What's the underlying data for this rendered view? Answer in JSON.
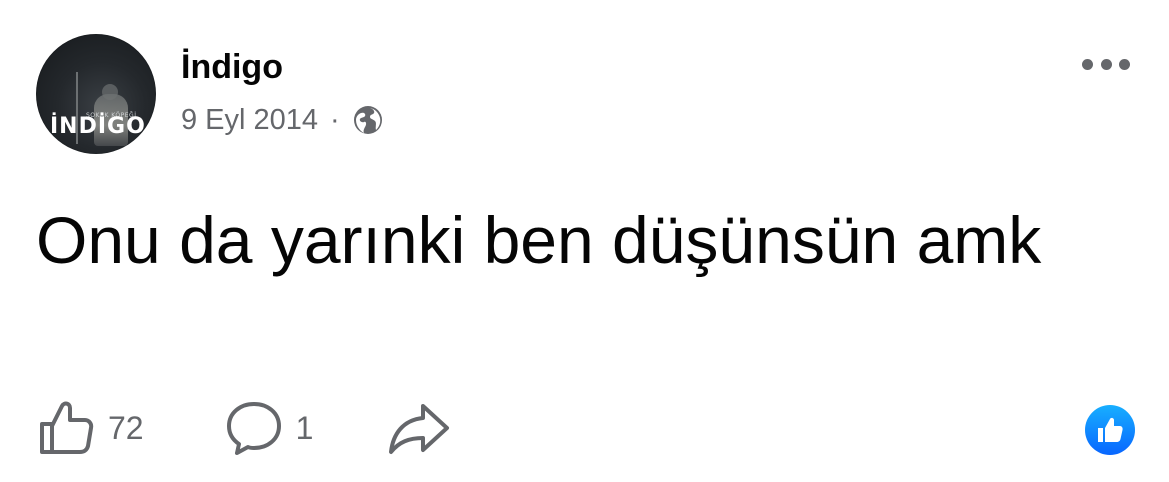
{
  "post": {
    "author": "İndigo",
    "date": "9 Eyl 2014",
    "separator": "·",
    "audience_icon": "globe-icon",
    "more_icon": "more-options-icon",
    "message": "Onu da yarınki ben düşünsün amk",
    "avatar": {
      "logo_text": "İNDİGO",
      "small_text": "SOKAK KÖPEĞİ"
    }
  },
  "actions": {
    "like_icon": "thumbs-up-icon",
    "like_count": "72",
    "comment_icon": "comment-bubble-icon",
    "comment_count": "1",
    "share_icon": "share-arrow-icon",
    "reaction_icon": "like-reaction-icon"
  },
  "colors": {
    "text_primary": "#050505",
    "text_secondary": "#65676b",
    "like_blue": "#0866ff"
  }
}
